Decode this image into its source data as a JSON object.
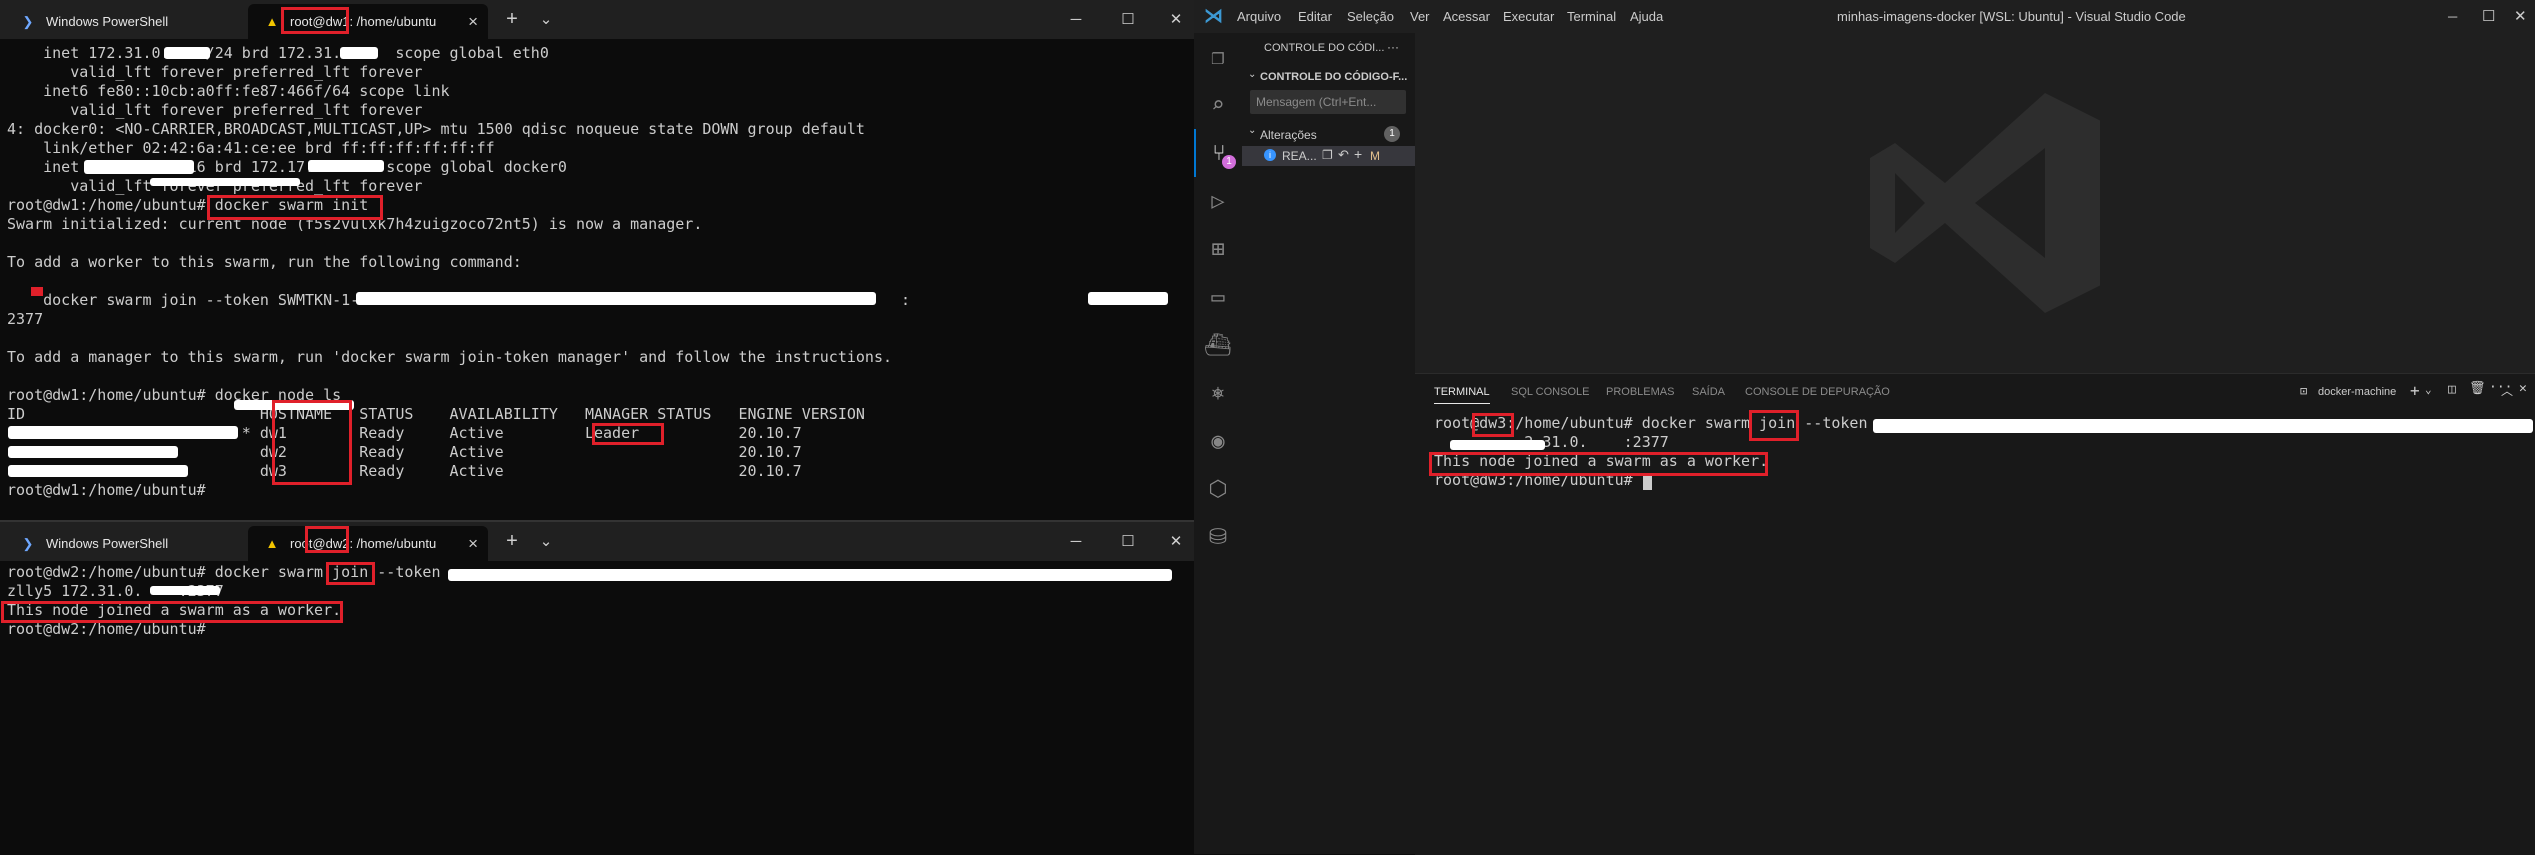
{
  "terminal_top": {
    "tabs": [
      {
        "label": "Windows PowerShell",
        "icon": "powershell-icon"
      },
      {
        "label": "root@dw1: /home/ubuntu",
        "icon": "linux-icon"
      }
    ],
    "new_tab": "+",
    "dropdown": "⌄",
    "controls": {
      "minimize": "─",
      "maximize": "☐",
      "close": "✕"
    },
    "lines": [
      "    inet 172.31.0.    /24 brd 172.31.0.    scope global eth0",
      "       valid_lft forever preferred_lft forever",
      "    inet6 fe80::10cb:a0ff:fe87:466f/64 scope link",
      "       valid_lft forever preferred_lft forever",
      "4: docker0: <NO-CARRIER,BROADCAST,MULTICAST,UP> mtu 1500 qdisc noqueue state DOWN group default",
      "    link/ether 02:42:6a:41:ce:ee brd ff:ff:ff:ff:ff:ff",
      "    inet           /16 brd 172.17.        scope global docker0",
      "       valid_lft forever preferred_lft forever",
      "root@dw1:/home/ubuntu# docker swarm init",
      "Swarm initialized: current node (f5s2vulxk7h4zuigzoco72nt5) is now a manager.",
      "",
      "To add a worker to this swarm, run the following command:",
      "",
      "    docker swarm join --token SWMTKN-1-                                               172.31.0.    :",
      "2377",
      "",
      "To add a manager to this swarm, run 'docker swarm join-token manager' and follow the instructions.",
      "",
      "root@dw1:/home/ubuntu# docker node ls",
      "ID                          HOSTNAME   STATUS    AVAILABILITY   MANAGER STATUS   ENGINE VERSION",
      "                          * dw1        Ready     Active         Leader           20.10.7",
      "                            dw2        Ready     Active                          20.10.7",
      "                            dw3        Ready     Active                          20.10.7",
      "root@dw1:/home/ubuntu#"
    ]
  },
  "terminal_bottom": {
    "tabs": [
      {
        "label": "Windows PowerShell",
        "icon": "powershell-icon"
      },
      {
        "label": "root@dw2: /home/ubuntu",
        "icon": "linux-icon"
      }
    ],
    "new_tab": "+",
    "dropdown": "⌄",
    "controls": {
      "minimize": "─",
      "maximize": "☐",
      "close": "✕"
    },
    "lines": [
      "root@dw2:/home/ubuntu# docker swarm join --token ",
      "zlly5 172.31.0.    :2377",
      "This node joined a swarm as a worker.",
      "root@dw2:/home/ubuntu#"
    ]
  },
  "vscode": {
    "window_title": "minhas-imagens-docker [WSL: Ubuntu] - Visual Studio Code",
    "menu": [
      "Arquivo",
      "Editar",
      "Seleção",
      "Ver",
      "Acessar",
      "Executar",
      "Terminal",
      "Ajuda"
    ],
    "controls": {
      "minimize": "─",
      "maximize": "☐",
      "close": "✕"
    },
    "sidebar": {
      "header": "CONTROLE DO CÓDI...",
      "header_more": "···",
      "section": "CONTROLE DO CÓDIGO-F...",
      "message_placeholder": "Mensagem (Ctrl+Ent...",
      "changes_label": "Alterações",
      "changes_count": "1",
      "file_name": "REA...",
      "file_status": "M"
    },
    "scm_badge": "1",
    "panel": {
      "tabs": [
        "TERMINAL",
        "SQL CONSOLE",
        "PROBLEMAS",
        "SAÍDA",
        "CONSOLE DE DEPURAÇÃO"
      ],
      "terminal_name": "docker-machine",
      "lines": [
        "root@dw3:/home/ubuntu# docker swarm join --token ",
        "          2.31.0.    :2377",
        "This node joined a swarm as a worker.",
        "root@dw3:/home/ubuntu# "
      ]
    },
    "colors": {
      "accent": "#0078d4",
      "badge": "#d16eda",
      "highlight": "#e0202a"
    }
  }
}
